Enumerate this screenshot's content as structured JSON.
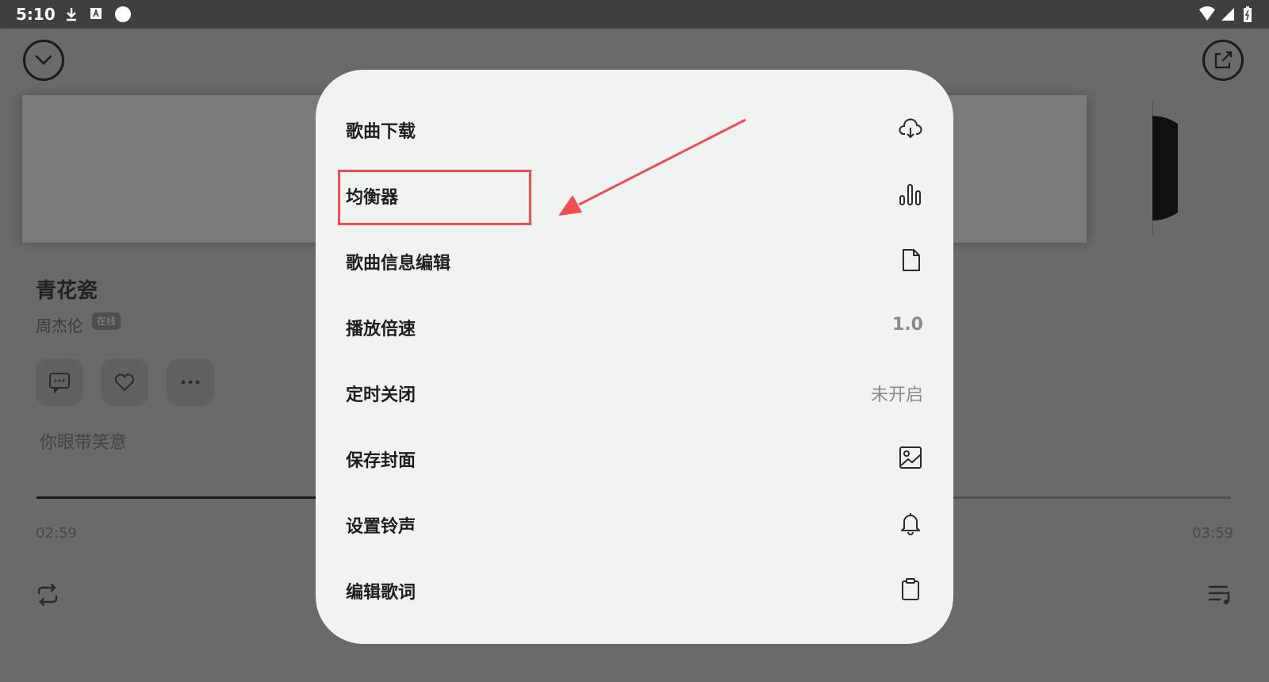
{
  "status_bar": {
    "time": "5:10"
  },
  "player": {
    "song_title": "青花瓷",
    "artist": "周杰伦",
    "badge": "在线",
    "lyric": "你眼带笑意",
    "current_time": "02:59",
    "total_time": "03:59",
    "progress": 0.26
  },
  "menu": {
    "items": [
      {
        "label": "歌曲下载",
        "icon": "cloud-download-icon"
      },
      {
        "label": "均衡器",
        "icon": "equalizer-icon"
      },
      {
        "label": "歌曲信息编辑",
        "icon": "document-icon"
      },
      {
        "label": "播放倍速",
        "value": "1.0"
      },
      {
        "label": "定时关闭",
        "value": "未开启"
      },
      {
        "label": "保存封面",
        "icon": "image-icon"
      },
      {
        "label": "设置铃声",
        "icon": "bell-icon"
      },
      {
        "label": "编辑歌词",
        "icon": "clipboard-icon"
      }
    ]
  },
  "colors": {
    "annotation": "#f14e54",
    "menu_background": "#f0f4f0",
    "overlay": "#6a6a6a"
  }
}
